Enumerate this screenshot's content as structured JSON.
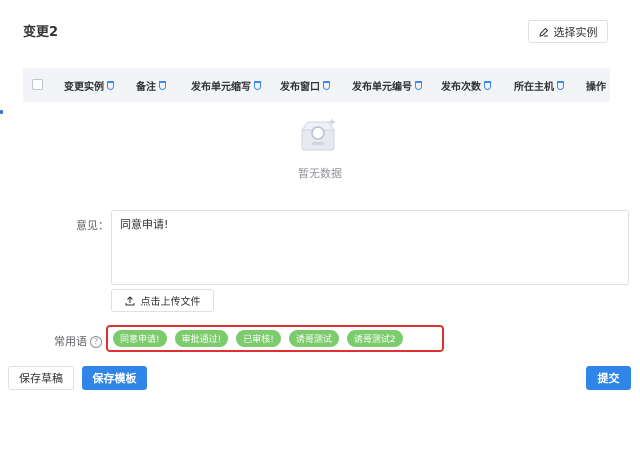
{
  "header": {
    "title": "变更2",
    "select_button_label": "选择实例",
    "select_button_icon": "edit-icon"
  },
  "table": {
    "columns": [
      "变更实例",
      "备注",
      "发布单元缩写",
      "发布窗口",
      "发布单元编号",
      "发布次数",
      "所在主机",
      "操作"
    ],
    "empty_text": "暂无数据"
  },
  "form": {
    "opinion_label": "意见：",
    "opinion_value": "同意申请!",
    "upload_label": "点击上传文件",
    "common_phrases_label": "常用语",
    "common_phrases": [
      "同意申请!",
      "审批通过!",
      "已审核!",
      "诱哥测试",
      "诱哥测试2"
    ]
  },
  "footer": {
    "save_draft_label": "保存草稿",
    "save_template_label": "保存模板",
    "submit_label": "提交"
  },
  "colors": {
    "primary": "#2f86e8",
    "tag": "#7ccb6d",
    "highlight_border": "#e03131",
    "table_header_bg": "#f2f4f7"
  }
}
